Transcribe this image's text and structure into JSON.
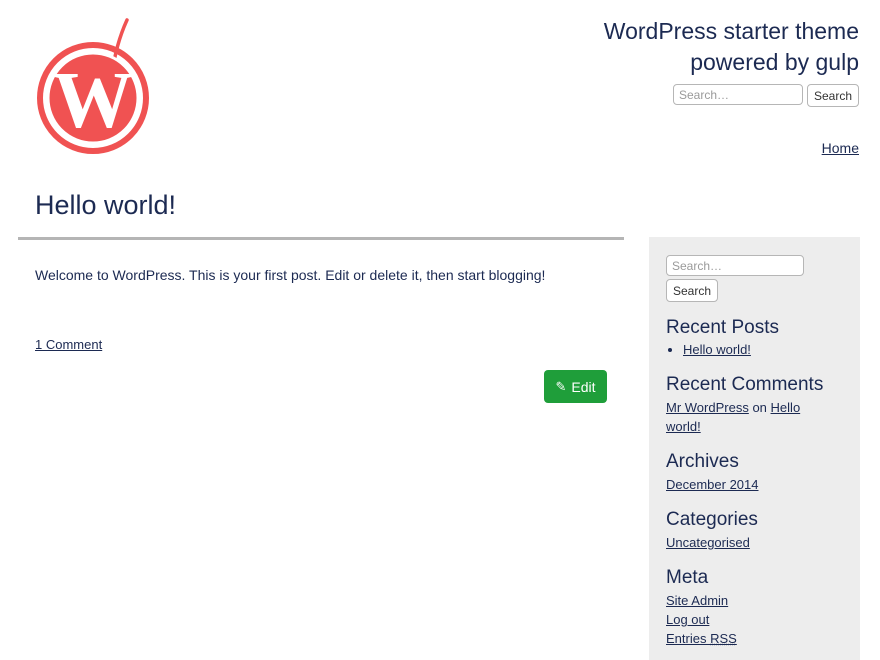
{
  "header": {
    "site_title_line1": "WordPress starter theme",
    "site_title_line2": "powered by gulp",
    "search_placeholder": "Search…",
    "search_button": "Search",
    "nav": [
      {
        "label": "Home"
      }
    ]
  },
  "post": {
    "title": "Hello world!",
    "body": "Welcome to WordPress. This is your first post. Edit or delete it, then start blogging!",
    "comments_link": "1 Comment",
    "edit_label": "Edit"
  },
  "sidebar": {
    "search_placeholder": "Search…",
    "search_button": "Search",
    "recent_posts": {
      "title": "Recent Posts",
      "items": [
        "Hello world!"
      ]
    },
    "recent_comments": {
      "title": "Recent Comments",
      "author": "Mr WordPress",
      "connector": "on",
      "post_line1": "Hello",
      "post_line2": "world!"
    },
    "archives": {
      "title": "Archives",
      "items": [
        "December 2014"
      ]
    },
    "categories": {
      "title": "Categories",
      "items": [
        "Uncategorised"
      ]
    },
    "meta": {
      "title": "Meta",
      "items": [
        "Site Admin",
        "Log out"
      ],
      "entries_prefix": "Entries ",
      "entries_abbr": "RSS"
    }
  },
  "colors": {
    "text": "#1c2a52",
    "logo_red": "#f05252",
    "edit_green": "#1f9e3a",
    "sidebar_bg": "#ededed",
    "rule_gray": "#b5b5b5"
  },
  "icons": {
    "logo": "wordpress-cherry-logo",
    "edit": "pencil-icon"
  }
}
